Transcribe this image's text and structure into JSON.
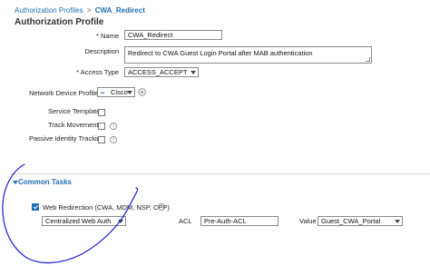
{
  "breadcrumb": {
    "parent": "Authorization Profiles",
    "separator": ">",
    "current": "CWA_Redirect"
  },
  "page_title": "Authorization Profile",
  "form": {
    "name": {
      "label": "* Name",
      "value": "CWA_Redirect"
    },
    "description": {
      "label": "Description",
      "value": "Redirect to CWA Guest Login Portal after MAB authentication"
    },
    "access_type": {
      "label": "* Access Type",
      "value": "ACCESS_ACCEPT"
    },
    "network_device_profile": {
      "label": "Network Device Profile",
      "value": "Cisco"
    },
    "service_template": {
      "label": "Service Template",
      "checked": false
    },
    "track_movement": {
      "label": "Track Movement",
      "checked": false
    },
    "passive_identity_tracking": {
      "label": "Passive Identity Tracking",
      "checked": false
    }
  },
  "common_tasks": {
    "title": "Common Tasks",
    "web_redirection": {
      "label": "Web Redirection (CWA, MDM, NSP, CPP)",
      "checked": true,
      "info": "i",
      "type_value": "Centralized Web Auth",
      "acl_label": "ACL",
      "acl_value": "Pre-Auth-ACL",
      "value_label": "Value",
      "value_value": "Guest_CWA_Portal"
    }
  },
  "annotation_color": "#1a1ad6",
  "accent_color": "#1f6fb5"
}
